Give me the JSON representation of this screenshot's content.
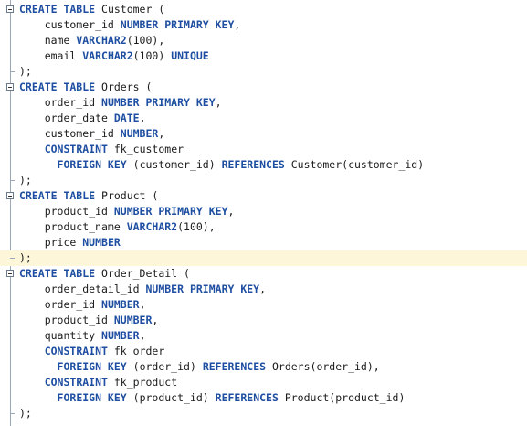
{
  "editor": {
    "lines": [
      [
        {
          "t": "CREATE TABLE",
          "k": 1
        },
        {
          "t": " Customer ("
        }
      ],
      [
        {
          "t": "    customer_id "
        },
        {
          "t": "NUMBER PRIMARY KEY",
          "k": 1
        },
        {
          "t": ","
        }
      ],
      [
        {
          "t": "    name "
        },
        {
          "t": "VARCHAR2",
          "k": 1
        },
        {
          "t": "(100),"
        }
      ],
      [
        {
          "t": "    email "
        },
        {
          "t": "VARCHAR2",
          "k": 1
        },
        {
          "t": "(100) "
        },
        {
          "t": "UNIQUE",
          "k": 1
        }
      ],
      [
        {
          "t": ");"
        }
      ],
      [
        {
          "t": "CREATE TABLE",
          "k": 1
        },
        {
          "t": " Orders ("
        }
      ],
      [
        {
          "t": "    order_id "
        },
        {
          "t": "NUMBER PRIMARY KEY",
          "k": 1
        },
        {
          "t": ","
        }
      ],
      [
        {
          "t": "    order_date "
        },
        {
          "t": "DATE",
          "k": 1
        },
        {
          "t": ","
        }
      ],
      [
        {
          "t": "    customer_id "
        },
        {
          "t": "NUMBER",
          "k": 1
        },
        {
          "t": ","
        }
      ],
      [
        {
          "t": "    "
        },
        {
          "t": "CONSTRAINT",
          "k": 1
        },
        {
          "t": " fk_customer"
        }
      ],
      [
        {
          "t": "      "
        },
        {
          "t": "FOREIGN KEY",
          "k": 1
        },
        {
          "t": " (customer_id) "
        },
        {
          "t": "REFERENCES",
          "k": 1
        },
        {
          "t": " Customer(customer_id)"
        }
      ],
      [
        {
          "t": ");"
        }
      ],
      [
        {
          "t": "CREATE TABLE",
          "k": 1
        },
        {
          "t": " Product ("
        }
      ],
      [
        {
          "t": "    product_id "
        },
        {
          "t": "NUMBER PRIMARY KEY",
          "k": 1
        },
        {
          "t": ","
        }
      ],
      [
        {
          "t": "    product_name "
        },
        {
          "t": "VARCHAR2",
          "k": 1
        },
        {
          "t": "(100),"
        }
      ],
      [
        {
          "t": "    price "
        },
        {
          "t": "NUMBER",
          "k": 1
        }
      ],
      [
        {
          "t": ");"
        }
      ],
      [
        {
          "t": "CREATE TABLE",
          "k": 1
        },
        {
          "t": " Order_Detail ("
        }
      ],
      [
        {
          "t": "    order_detail_id "
        },
        {
          "t": "NUMBER PRIMARY KEY",
          "k": 1
        },
        {
          "t": ","
        }
      ],
      [
        {
          "t": "    order_id "
        },
        {
          "t": "NUMBER",
          "k": 1
        },
        {
          "t": ","
        }
      ],
      [
        {
          "t": "    product_id "
        },
        {
          "t": "NUMBER",
          "k": 1
        },
        {
          "t": ","
        }
      ],
      [
        {
          "t": "    quantity "
        },
        {
          "t": "NUMBER",
          "k": 1
        },
        {
          "t": ","
        }
      ],
      [
        {
          "t": "    "
        },
        {
          "t": "CONSTRAINT",
          "k": 1
        },
        {
          "t": " fk_order"
        }
      ],
      [
        {
          "t": "      "
        },
        {
          "t": "FOREIGN KEY",
          "k": 1
        },
        {
          "t": " (order_id) "
        },
        {
          "t": "REFERENCES",
          "k": 1
        },
        {
          "t": " Orders(order_id),"
        }
      ],
      [
        {
          "t": "    "
        },
        {
          "t": "CONSTRAINT",
          "k": 1
        },
        {
          "t": " fk_product"
        }
      ],
      [
        {
          "t": "      "
        },
        {
          "t": "FOREIGN KEY",
          "k": 1
        },
        {
          "t": " (product_id) "
        },
        {
          "t": "REFERENCES",
          "k": 1
        },
        {
          "t": " Product(product_id)"
        }
      ],
      [
        {
          "t": ");"
        }
      ]
    ],
    "fold_lines": [
      0,
      5,
      12,
      17
    ],
    "end_lines": [
      4,
      11,
      16,
      26
    ],
    "highlighted_line": 16
  },
  "colors": {
    "keyword": "#1e4ea1",
    "text": "#1a1a1a",
    "current_line": "#fdf6d9"
  }
}
